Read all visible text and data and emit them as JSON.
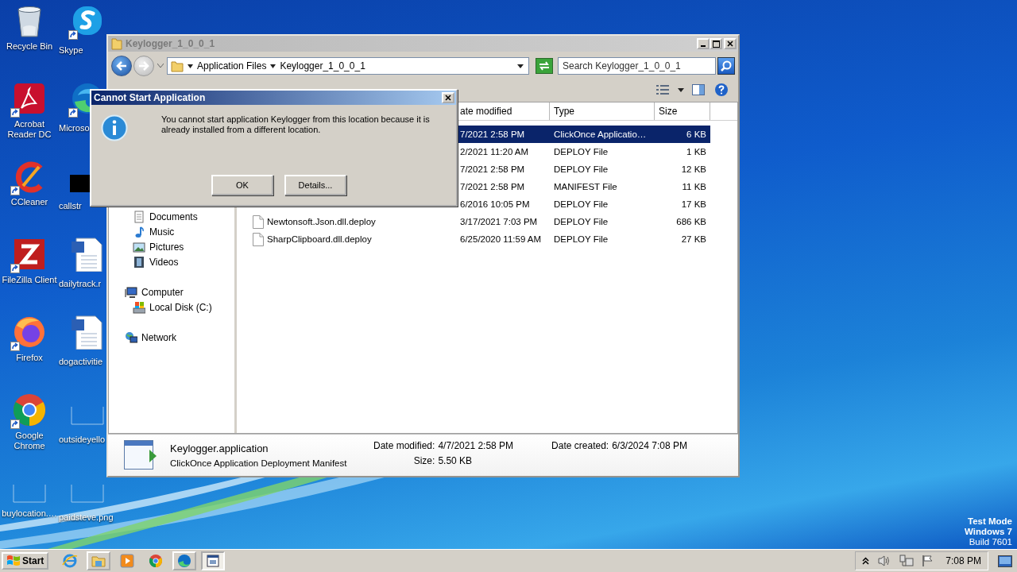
{
  "desktop_icons": [
    {
      "label": "Recycle Bin",
      "kind": "recycle-bin",
      "shortcut": false
    },
    {
      "label": "Skype",
      "kind": "skype",
      "shortcut": true
    },
    {
      "label": "Acrobat Reader DC",
      "kind": "acrobat",
      "shortcut": true
    },
    {
      "label": "Microso",
      "kind": "edge",
      "shortcut": true
    },
    {
      "label": "CCleaner",
      "kind": "ccleaner",
      "shortcut": true
    },
    {
      "label": "callstr",
      "kind": "black-thumb",
      "shortcut": false
    },
    {
      "label": "FileZilla Client",
      "kind": "filezilla",
      "shortcut": true
    },
    {
      "label": "dailytrack.r",
      "kind": "word-doc",
      "shortcut": false
    },
    {
      "label": "Firefox",
      "kind": "firefox",
      "shortcut": true
    },
    {
      "label": "dogactivitie",
      "kind": "word-doc",
      "shortcut": false
    },
    {
      "label": "Google Chrome",
      "kind": "chrome",
      "shortcut": true
    },
    {
      "label": "outsideyello",
      "kind": "blank-thumb",
      "shortcut": false
    },
    {
      "label": "buylocation.…",
      "kind": "blank-thumb",
      "shortcut": false
    },
    {
      "label": "paidsteve.png",
      "kind": "blank-thumb",
      "shortcut": false
    }
  ],
  "explorer": {
    "title": "Keylogger_1_0_0_1",
    "breadcrumb": [
      "Application Files",
      "Keylogger_1_0_0_1"
    ],
    "search": {
      "placeholder": "Search Keylogger_1_0_0_1"
    },
    "nav_groups": [
      {
        "children": [
          {
            "label": "Documents",
            "kind": "documents"
          },
          {
            "label": "Music",
            "kind": "music"
          },
          {
            "label": "Pictures",
            "kind": "pictures"
          },
          {
            "label": "Videos",
            "kind": "videos"
          }
        ]
      },
      {
        "label": "Computer",
        "kind": "computer",
        "children": [
          {
            "label": "Local Disk (C:)",
            "kind": "disk"
          }
        ]
      },
      {
        "label": "Network",
        "kind": "network"
      }
    ],
    "columns": [
      "ate modified",
      "Type",
      "Size"
    ],
    "files": [
      {
        "date": "7/2021 2:58 PM",
        "type": "ClickOnce Applicatio…",
        "size": "6 KB",
        "selected": true
      },
      {
        "date": "2/2021 11:20 AM",
        "type": "DEPLOY File",
        "size": "1 KB",
        "selected": false
      },
      {
        "date": "7/2021 2:58 PM",
        "type": "DEPLOY File",
        "size": "12 KB",
        "selected": false
      },
      {
        "date": "7/2021 2:58 PM",
        "type": "MANIFEST File",
        "size": "11 KB",
        "selected": false
      },
      {
        "date": "6/2016 10:05 PM",
        "type": "DEPLOY File",
        "size": "17 KB",
        "selected": false
      },
      {
        "name": "Newtonsoft.Json.dll.deploy",
        "date": "3/17/2021 7:03 PM",
        "type": "DEPLOY File",
        "size": "686 KB",
        "selected": false
      },
      {
        "name": "SharpClipboard.dll.deploy",
        "date": "6/25/2020 11:59 AM",
        "type": "DEPLOY File",
        "size": "27 KB",
        "selected": false
      }
    ],
    "details": {
      "name": "Keylogger.application",
      "type": "ClickOnce Application Deployment Manifest",
      "modified_label": "Date modified:",
      "modified": "4/7/2021 2:58 PM",
      "size_label": "Size:",
      "size": "5.50 KB",
      "created_label": "Date created:",
      "created": "6/3/2024 7:08 PM"
    }
  },
  "dialog": {
    "title": "Cannot Start Application",
    "message": "You cannot start application Keylogger from this location because it is already installed from a different location.",
    "buttons": [
      "OK",
      "Details..."
    ]
  },
  "system_text": [
    {
      "text": "Test Mode",
      "bold": true
    },
    {
      "text": "Windows 7",
      "bold": true
    },
    {
      "text": "Build 7601",
      "bold": false
    }
  ],
  "taskbar": {
    "start": "Start",
    "apps": [
      {
        "kind": "ie",
        "running": false,
        "active": false
      },
      {
        "kind": "folder",
        "running": true,
        "active": false
      },
      {
        "kind": "media",
        "running": false,
        "active": false
      },
      {
        "kind": "chrome",
        "running": false,
        "active": false
      },
      {
        "kind": "edge",
        "running": true,
        "active": false
      },
      {
        "kind": "app-window",
        "running": true,
        "active": true
      }
    ],
    "clock": "7:08 PM"
  }
}
